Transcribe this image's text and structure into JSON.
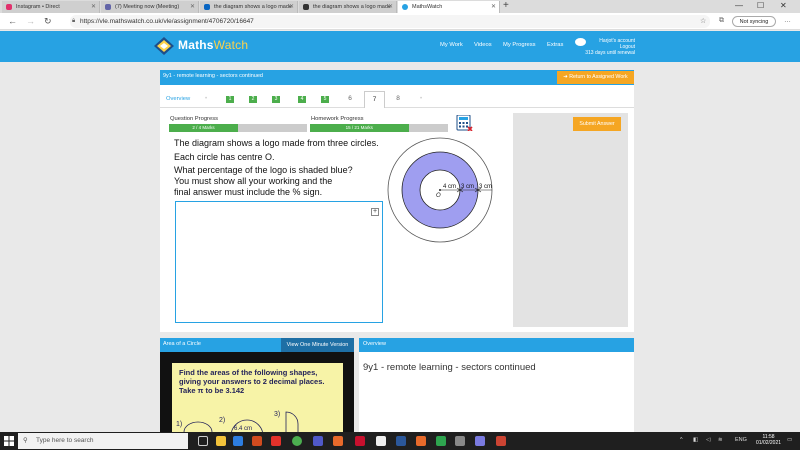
{
  "browser": {
    "tabs": [
      {
        "label": "Instagram • Direct",
        "color": "#e1306c"
      },
      {
        "label": "(7) Meeting now (Meeting)",
        "color": "#6264a7"
      },
      {
        "label": "the diagram shows a logo made",
        "color": "#0a66c2"
      },
      {
        "label": "the diagram shows a logo made",
        "color": "#333333"
      },
      {
        "label": "MathsWatch",
        "color": "#27a2e3"
      }
    ],
    "url": "https://vle.mathswatch.co.uk/vle/assignment/4706720/16647",
    "sync_label": "Not syncing"
  },
  "site": {
    "logo_text_a": "Maths",
    "logo_text_b": "Watch",
    "nav": [
      "My Work",
      "Videos",
      "My Progress",
      "Extras"
    ],
    "account_name": "Harjot's account",
    "logout": "Logout",
    "renewal": "313 days until renewal"
  },
  "assignment": {
    "title": "9y1 - remote learning - sectors continued",
    "return_label": "Return to Assigned Work",
    "overview_tab": "Overview",
    "questions": [
      "1",
      "2",
      "3",
      "4",
      "5",
      "6",
      "7",
      "8"
    ],
    "question_progress_label": "Question Progress",
    "question_progress_text": "2 / 4 Marks",
    "question_progress": 0.5,
    "homework_progress_label": "Homework Progress",
    "homework_progress_text": "15 / 21 Marks",
    "homework_progress": 0.714,
    "question_lines": [
      "The diagram shows a logo made from three circles.",
      "Each circle has centre O.",
      "What percentage of the logo is shaded blue?",
      "You must show all your working and the",
      "final answer must include the % sign."
    ],
    "diagram_labels": {
      "a": "4 cm",
      "b": "3 cm",
      "c": "3 cm",
      "centre": "O"
    },
    "submit_label": "Submit Answer"
  },
  "video": {
    "header": "Area of a Circle",
    "button": "View One Minute Version",
    "lines": [
      "Find the areas of the following shapes,",
      "giving your answers to 2 decimal places.",
      "Take π to be 3.142"
    ],
    "fragment_a": "1)",
    "fragment_b": "2)",
    "fragment_c": "3)",
    "fragment_d": "6.4 cm"
  },
  "overview": {
    "header": "Overview",
    "text": "9y1 - remote learning - sectors continued"
  },
  "taskbar": {
    "search_placeholder": "Type here to search",
    "lang": "ENG",
    "time": "11:58",
    "date": "01/02/2021"
  }
}
